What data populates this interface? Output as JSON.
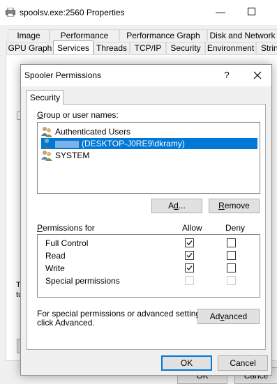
{
  "background_window": {
    "title": "spoolsv.exe:2560 Properties",
    "minimize_glyph": "—",
    "tabs_row1": [
      "Image",
      "Performance",
      "Performance Graph",
      "Disk and Network"
    ],
    "tabs_row2": [
      "GPU Graph",
      "Services",
      "Threads",
      "TCP/IP",
      "Security",
      "Environment",
      "Strin"
    ],
    "selected_tab": "Services",
    "fragment_text_1": "Th",
    "fragment_text_2": "tu",
    "fragment_text_3": "S",
    "ok_label": "OK",
    "cancel_label": "Cance"
  },
  "dialog": {
    "title": "Spooler Permissions",
    "help_glyph": "?",
    "tab_label": "Security",
    "group_label_accel": "G",
    "group_label_rest": "roup or user names:",
    "users": [
      {
        "name": "Authenticated Users",
        "icon": "users-group-icon",
        "selected": false
      },
      {
        "name": "(DESKTOP-J0RE9\\dkramy)",
        "icon": "user-icon",
        "selected": true
      },
      {
        "name": "SYSTEM",
        "icon": "users-group-icon",
        "selected": false
      }
    ],
    "add_accel": "d",
    "add_pre": "A",
    "add_post": "...",
    "remove_accel": "R",
    "remove_post": "emove",
    "permissions_label_accel": "P",
    "permissions_label_rest": "ermissions for",
    "permissions_for_target": "",
    "allow_header": "Allow",
    "deny_header": "Deny",
    "permissions": [
      {
        "name": "Full Control",
        "allow": true,
        "deny": false,
        "enabled": true
      },
      {
        "name": "Read",
        "allow": true,
        "deny": false,
        "enabled": true
      },
      {
        "name": "Write",
        "allow": true,
        "deny": false,
        "enabled": true
      },
      {
        "name": "Special permissions",
        "allow": false,
        "deny": false,
        "enabled": false
      }
    ],
    "advanced_note_line1": "For special permissions or advanced settings,",
    "advanced_note_line2": "click Advanced.",
    "advanced_pre": "Ad",
    "advanced_accel": "v",
    "advanced_post": "anced",
    "ok_label": "OK",
    "cancel_label": "Cancel"
  },
  "colors": {
    "selection": "#0078d7",
    "dialog_bg": "#f0f0f0",
    "button_bg": "#e1e1e1"
  }
}
